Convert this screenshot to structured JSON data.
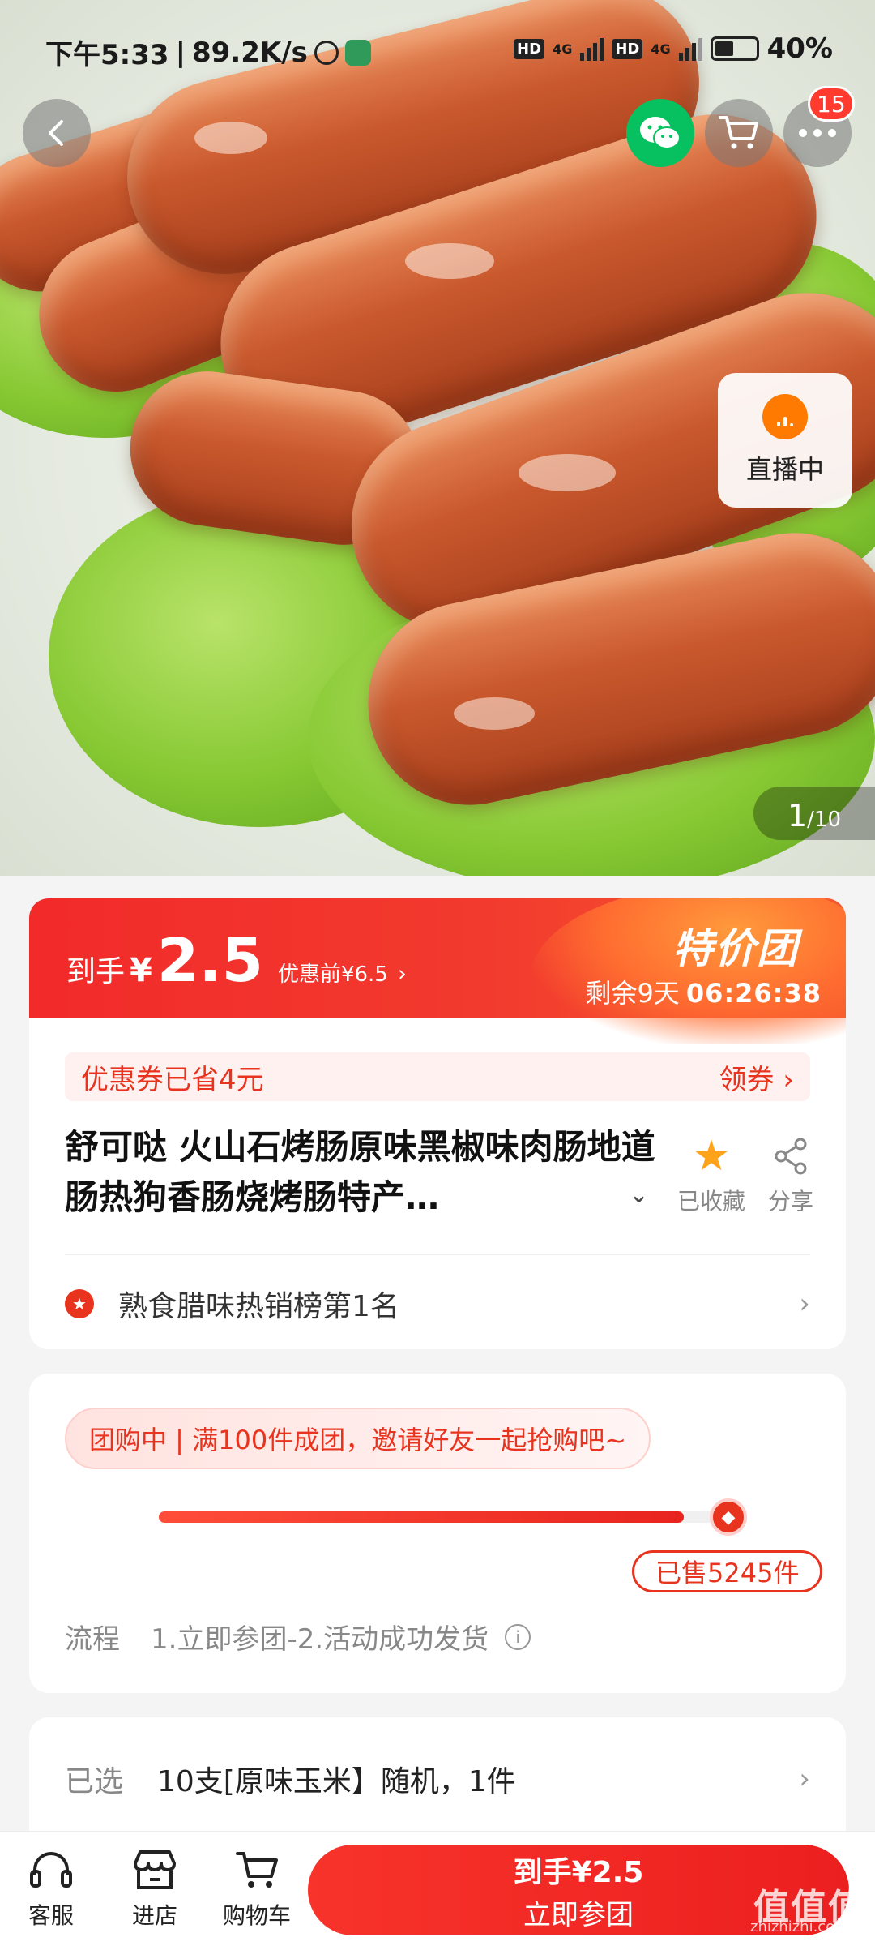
{
  "status": {
    "time": "下午5:33",
    "speed": "89.2K/s",
    "hd1": "HD",
    "net1": "4G",
    "hd2": "HD",
    "net2": "4G",
    "battery": "40%"
  },
  "nav": {
    "cart_badge": "15"
  },
  "gallery": {
    "current": "1",
    "total": "/10",
    "live_label": "直播中"
  },
  "price": {
    "daoshou": "到手",
    "yen": "¥",
    "amount": "2.5",
    "original": "优惠前¥6.5",
    "arrow": "›",
    "badge": "特价团",
    "remaining_label": "剩余9天",
    "remaining_time": "06:26:38"
  },
  "coupon": {
    "text": "优惠券已省4元",
    "action": "领券 ›"
  },
  "product": {
    "title": "舒可哒 火山石烤肠原味黑椒味肉肠地道肠热狗香肠烧烤肠特产…",
    "expand": "⌄",
    "favorite_label": "已收藏",
    "share_label": "分享"
  },
  "rank": {
    "text": "熟食腊味热销榜第1名",
    "chevron": "›"
  },
  "group": {
    "status": "团购中 | 满100件成团，邀请好友一起抢购吧~",
    "progress": 0.9,
    "sold": "已售5245件",
    "flow_label": "流程",
    "flow_text": "1.立即参团-2.活动成功发货",
    "info": "i"
  },
  "selection": {
    "label": "已选",
    "value": "10支[原味玉米】随机，1件",
    "chevron": "›"
  },
  "bottom": {
    "service": "客服",
    "store": "进店",
    "cart": "购物车",
    "buy_price": "到手¥2.5",
    "buy_action": "立即参团"
  },
  "watermark": {
    "text": "值值值",
    "sub": "zhizhizhi.com"
  },
  "colors": {
    "accent": "#e8341f",
    "wechat": "#07c160",
    "live": "#ff7a00",
    "star": "#ffa31a"
  }
}
